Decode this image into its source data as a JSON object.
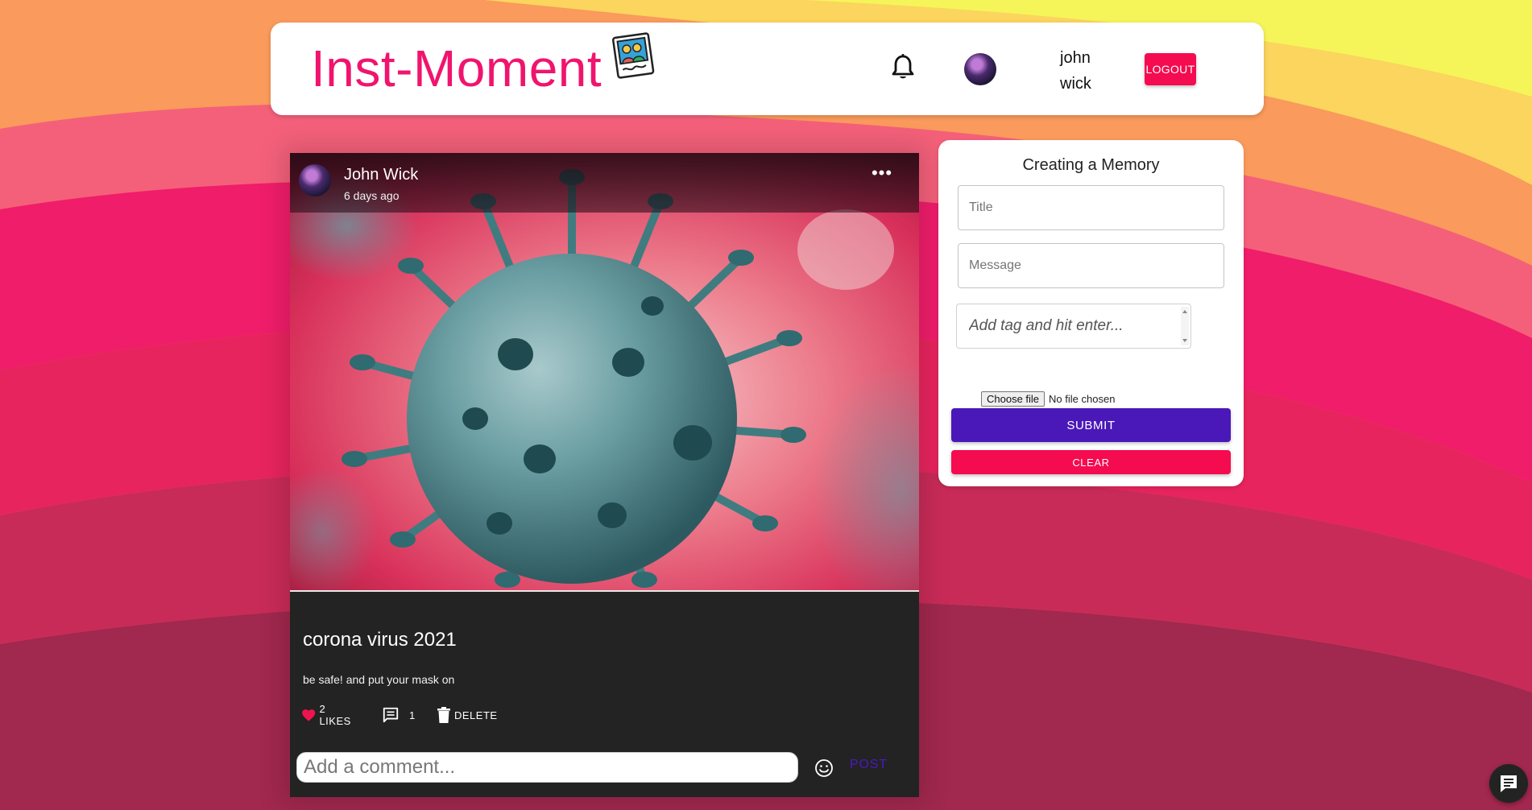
{
  "header": {
    "brand_title": "Inst-Moment",
    "user_name": "john wick",
    "logout_label": "LOGOUT",
    "icons": [
      "bell-icon",
      "photo-logo-icon",
      "avatar"
    ]
  },
  "post": {
    "author": "John Wick",
    "time": "6 days ago",
    "title": "corona virus 2021",
    "message": "be safe! and put your mask on",
    "likes_label": "2 LIKES",
    "comments_count": "1",
    "delete_label": "DELETE",
    "comment_placeholder": "Add a comment...",
    "post_label": "POST"
  },
  "form": {
    "title": "Creating a Memory",
    "title_placeholder": "Title",
    "message_placeholder": "Message",
    "tag_placeholder": "Add tag and hit enter...",
    "file_button": "Choose file",
    "file_status": "No file chosen",
    "submit_label": "SUBMIT",
    "clear_label": "CLEAR"
  },
  "colors": {
    "brand": "#f0146e",
    "submit": "#4a18b8",
    "danger": "#f50b4f",
    "card_dark": "#232323"
  }
}
